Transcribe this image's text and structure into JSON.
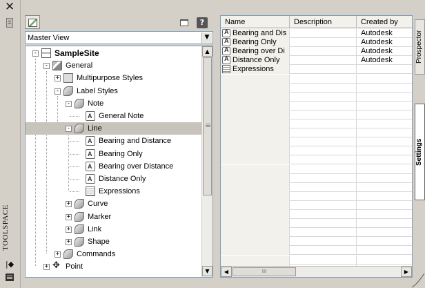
{
  "palette": {
    "title": "TOOLSPACE",
    "close_icon": "close-icon",
    "auto_hide_icon": "auto-hide-icon"
  },
  "toolbar": {
    "view_button_icon": "view-toggle-icon",
    "window_icon": "window-icon",
    "help_label": "?"
  },
  "view_select": {
    "value": "Master View"
  },
  "tree": {
    "nodes": [
      {
        "label": "SampleSite",
        "icon": "site-icon"
      },
      {
        "label": "General",
        "icon": "general-icon"
      },
      {
        "label": "Multipurpose Styles",
        "icon": "multipurpose-styles-icon"
      },
      {
        "label": "Label Styles",
        "icon": "label-styles-icon"
      },
      {
        "label": "Note",
        "icon": "style-folder-icon"
      },
      {
        "label": "General Note",
        "icon": "label-style-icon"
      },
      {
        "label": "Line",
        "icon": "style-folder-icon"
      },
      {
        "label": "Bearing and Distance",
        "icon": "label-style-icon"
      },
      {
        "label": "Bearing Only",
        "icon": "label-style-icon"
      },
      {
        "label": "Bearing over Distance",
        "icon": "label-style-icon"
      },
      {
        "label": "Distance Only",
        "icon": "label-style-icon"
      },
      {
        "label": "Expressions",
        "icon": "expressions-icon"
      },
      {
        "label": "Curve",
        "icon": "style-folder-icon"
      },
      {
        "label": "Marker",
        "icon": "style-folder-icon"
      },
      {
        "label": "Link",
        "icon": "style-folder-icon"
      },
      {
        "label": "Shape",
        "icon": "style-folder-icon"
      },
      {
        "label": "Commands",
        "icon": "commands-icon"
      },
      {
        "label": "Point",
        "icon": "point-icon"
      }
    ]
  },
  "grid": {
    "columns": [
      "Name",
      "Description",
      "Created by"
    ],
    "rows": [
      {
        "name": "Bearing and Dis",
        "description": "",
        "created_by": "Autodesk"
      },
      {
        "name": "Bearing Only",
        "description": "",
        "created_by": "Autodesk"
      },
      {
        "name": "Bearing over Di",
        "description": "",
        "created_by": "Autodesk"
      },
      {
        "name": "Distance Only",
        "description": "",
        "created_by": "Autodesk"
      },
      {
        "name": "Expressions",
        "description": "",
        "created_by": ""
      }
    ],
    "hscroll_thumb": "III"
  },
  "tabs": [
    {
      "label": "Prospector"
    },
    {
      "label": "Settings"
    }
  ]
}
